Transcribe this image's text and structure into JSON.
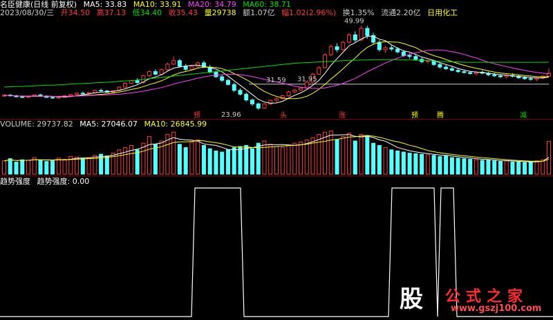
{
  "header": {
    "stock_name": "名臣健康(日线 前复权)",
    "ma5": "MA5: 33.83",
    "ma10": "MA10: 33.91",
    "ma20": "MA20: 34.79",
    "ma60": "MA60: 38.71",
    "date": "2023/08/30/三",
    "open": "开34.50",
    "high": "高37.13",
    "low": "低34.40",
    "close": "收35.43",
    "volume": "量29738",
    "amount": "额1.07亿",
    "change": "幅1.02(2.96%)",
    "turnover": "换1.35%",
    "float": "流通2.20亿",
    "industry": "日用化工"
  },
  "volume_header": {
    "volume": "VOLUME: 29737.82",
    "ma5": "MA5: 27046.07",
    "ma10": "MA10: 26845.99"
  },
  "indicator_header": {
    "name": "趋势强度",
    "value": "趋势强度: 0.00"
  },
  "watermark": {
    "char": "股",
    "text": "公式之家",
    "url": "www.gszj100.com"
  },
  "colors": {
    "up": "#ff3b3b",
    "down": "#54ffff",
    "ma5": "#ffffff",
    "ma10": "#ffff00",
    "ma20": "#ff40ff",
    "ma60": "#00e000",
    "volma5": "#ffffff",
    "volma10": "#ffff00",
    "trend": "#ffffff",
    "sep": "#7a0000"
  },
  "chart_data": [
    {
      "type": "candlestick",
      "price_range": [
        22,
        52
      ],
      "annotations": [
        {
          "label": "49.99",
          "value": 49.99
        },
        {
          "label": "23.96",
          "value": 23.96
        },
        {
          "label": "31.59",
          "value": 31.59
        },
        {
          "label": "31.95",
          "value": 31.95
        }
      ],
      "markers": [
        "预",
        "头",
        "涨",
        "预",
        "腾",
        "减"
      ],
      "candles": [
        [
          28.2,
          28.8,
          27.9,
          28.5
        ],
        [
          28.5,
          28.9,
          28.1,
          28.3
        ],
        [
          28.3,
          28.6,
          27.8,
          28.0
        ],
        [
          28.0,
          28.4,
          27.6,
          27.9
        ],
        [
          27.9,
          28.3,
          27.5,
          28.2
        ],
        [
          28.2,
          28.7,
          28.0,
          28.6
        ],
        [
          28.6,
          28.9,
          28.1,
          28.2
        ],
        [
          28.2,
          28.5,
          27.7,
          27.8
        ],
        [
          27.8,
          28.1,
          27.4,
          27.6
        ],
        [
          27.6,
          28.0,
          27.3,
          27.9
        ],
        [
          27.9,
          28.4,
          27.7,
          28.3
        ],
        [
          28.3,
          28.8,
          28.1,
          28.7
        ],
        [
          28.7,
          29.3,
          28.5,
          29.1
        ],
        [
          29.1,
          29.6,
          28.8,
          29.0
        ],
        [
          29.0,
          29.4,
          28.6,
          29.3
        ],
        [
          29.3,
          30.2,
          29.1,
          30.0
        ],
        [
          30.0,
          30.5,
          29.6,
          29.8
        ],
        [
          29.8,
          30.1,
          29.2,
          29.4
        ],
        [
          29.4,
          30.0,
          29.2,
          29.9
        ],
        [
          29.9,
          31.2,
          29.7,
          31.0
        ],
        [
          31.0,
          32.5,
          30.8,
          32.2
        ],
        [
          32.2,
          33.3,
          31.8,
          33.0
        ],
        [
          33.0,
          33.8,
          32.0,
          32.4
        ],
        [
          32.4,
          34.8,
          32.1,
          34.5
        ],
        [
          34.5,
          36.2,
          34.0,
          35.8
        ],
        [
          35.8,
          36.5,
          34.6,
          35.0
        ],
        [
          35.0,
          36.8,
          34.8,
          36.4
        ],
        [
          36.4,
          38.6,
          36.0,
          38.1
        ],
        [
          38.1,
          40.5,
          37.8,
          39.2
        ],
        [
          39.2,
          39.8,
          37.0,
          37.5
        ],
        [
          37.5,
          38.2,
          36.0,
          36.5
        ],
        [
          36.5,
          37.8,
          36.2,
          37.4
        ],
        [
          37.4,
          38.9,
          37.0,
          38.5
        ],
        [
          38.5,
          39.2,
          36.9,
          37.2
        ],
        [
          37.2,
          37.9,
          35.2,
          35.6
        ],
        [
          35.6,
          36.1,
          33.9,
          34.2
        ],
        [
          34.2,
          34.8,
          32.6,
          33.1
        ],
        [
          33.1,
          33.5,
          31.5,
          31.8
        ],
        [
          31.8,
          32.4,
          29.5,
          30.0
        ],
        [
          30.0,
          30.6,
          28.4,
          28.8
        ],
        [
          28.8,
          29.3,
          26.5,
          27.0
        ],
        [
          27.0,
          27.5,
          25.2,
          25.8
        ],
        [
          25.8,
          26.2,
          23.96,
          24.5
        ],
        [
          24.5,
          26.0,
          24.3,
          25.8
        ],
        [
          25.8,
          27.2,
          25.5,
          26.9
        ],
        [
          26.9,
          27.8,
          26.2,
          27.4
        ],
        [
          27.4,
          28.6,
          27.2,
          28.3
        ],
        [
          28.3,
          29.8,
          28.0,
          29.5
        ],
        [
          29.5,
          30.4,
          29.0,
          30.1
        ],
        [
          30.1,
          31.0,
          29.7,
          30.7
        ],
        [
          30.7,
          32.8,
          30.5,
          32.5
        ],
        [
          32.5,
          35.4,
          32.2,
          35.0
        ],
        [
          35.0,
          37.5,
          34.8,
          37.0
        ],
        [
          37.0,
          41.5,
          36.8,
          41.0
        ],
        [
          41.0,
          44.2,
          40.6,
          43.5
        ],
        [
          43.5,
          44.6,
          41.8,
          42.6
        ],
        [
          42.6,
          45.3,
          42.2,
          44.9
        ],
        [
          44.9,
          47.8,
          44.5,
          47.2
        ],
        [
          47.2,
          48.3,
          44.9,
          45.6
        ],
        [
          45.6,
          49.99,
          45.2,
          49.2
        ],
        [
          49.2,
          50.0,
          46.0,
          47.0
        ],
        [
          47.0,
          47.9,
          44.4,
          44.9
        ],
        [
          44.9,
          45.6,
          42.0,
          42.6
        ],
        [
          42.6,
          43.8,
          41.6,
          43.2
        ],
        [
          43.2,
          44.0,
          42.2,
          42.8
        ],
        [
          42.8,
          43.4,
          41.5,
          41.9
        ],
        [
          41.9,
          42.4,
          40.4,
          40.8
        ],
        [
          40.8,
          41.5,
          39.8,
          40.5
        ],
        [
          40.5,
          41.1,
          39.2,
          39.6
        ],
        [
          39.6,
          40.2,
          38.4,
          38.9
        ],
        [
          38.9,
          39.6,
          38.3,
          39.2
        ],
        [
          39.2,
          39.5,
          37.6,
          38.0
        ],
        [
          38.0,
          38.5,
          36.8,
          37.2
        ],
        [
          37.2,
          37.9,
          36.3,
          36.7
        ],
        [
          36.7,
          37.3,
          35.9,
          36.2
        ],
        [
          36.2,
          36.9,
          35.4,
          35.8
        ],
        [
          35.8,
          36.4,
          35.2,
          35.5
        ],
        [
          35.5,
          36.0,
          34.8,
          35.2
        ],
        [
          35.2,
          35.9,
          34.6,
          35.6
        ],
        [
          35.6,
          36.2,
          35.0,
          35.3
        ],
        [
          35.3,
          35.8,
          34.4,
          34.8
        ],
        [
          34.8,
          35.4,
          34.1,
          34.5
        ],
        [
          34.5,
          35.0,
          33.8,
          34.2
        ],
        [
          34.2,
          34.9,
          33.6,
          34.6
        ],
        [
          34.6,
          35.3,
          34.0,
          34.4
        ],
        [
          34.4,
          34.8,
          33.5,
          33.9
        ],
        [
          33.9,
          34.4,
          33.2,
          33.6
        ],
        [
          33.6,
          34.2,
          33.0,
          33.4
        ],
        [
          33.4,
          34.1,
          32.9,
          33.8
        ],
        [
          33.8,
          34.6,
          33.4,
          34.4
        ],
        [
          34.4,
          36.8,
          34.0,
          35.3
        ]
      ],
      "ma60": [
        31.0,
        31.1,
        31.2,
        31.2,
        31.3,
        31.4,
        31.5,
        31.6,
        31.6,
        31.7,
        31.8,
        31.9,
        32.0,
        32.1,
        32.2,
        32.3,
        32.4,
        32.5,
        32.6,
        32.8,
        32.9,
        33.0,
        33.2,
        33.4,
        33.6,
        33.8,
        34.0,
        34.2,
        34.4,
        34.6,
        34.8,
        35.0,
        35.2,
        35.4,
        35.6,
        35.8,
        36.0,
        36.2,
        36.4,
        36.6,
        36.8,
        37.0,
        37.2,
        37.4,
        37.6,
        37.8,
        38.0,
        38.2,
        38.4,
        38.5,
        38.6,
        38.7,
        38.8,
        38.9,
        39.0,
        39.1,
        39.2,
        39.3,
        39.3,
        39.4,
        39.4,
        39.5,
        39.5,
        39.5,
        39.5,
        39.5,
        39.4,
        39.4,
        39.3,
        39.3,
        39.2,
        39.1,
        39.0,
        38.9,
        38.8,
        38.8,
        38.7,
        38.7,
        38.7,
        38.7,
        38.7,
        38.7,
        38.7,
        38.7,
        38.7,
        38.7,
        38.7,
        38.7,
        38.7,
        38.7,
        38.71
      ]
    },
    {
      "type": "bar",
      "name": "VOLUME",
      "ylim": [
        0,
        40000
      ],
      "values": [
        12000,
        14000,
        11000,
        13000,
        12500,
        15000,
        13000,
        11500,
        12000,
        14500,
        13500,
        16000,
        15500,
        14000,
        15000,
        17000,
        18000,
        16500,
        19000,
        22000,
        24000,
        26000,
        22000,
        28000,
        34000,
        27000,
        30000,
        36000,
        38000,
        27000,
        24000,
        29000,
        31000,
        26000,
        23000,
        21000,
        20000,
        22000,
        24000,
        25000,
        26000,
        23000,
        28000,
        30000,
        27000,
        25000,
        24000,
        26000,
        28000,
        29000,
        31000,
        33000,
        36000,
        38000,
        39000,
        31000,
        34000,
        37000,
        30000,
        36000,
        35000,
        28000,
        26000,
        24000,
        22000,
        21000,
        20000,
        19000,
        18500,
        18000,
        17500,
        17000,
        16000,
        16500,
        15000,
        14500,
        14000,
        13500,
        13000,
        12500,
        13000,
        12000,
        11500,
        12000,
        11000,
        11500,
        10500,
        11000,
        12000,
        13000,
        29737
      ]
    },
    {
      "type": "line",
      "name": "趋势强度",
      "ylim": [
        0,
        1
      ],
      "x": [
        0,
        300,
        360,
        645,
        700,
        720,
        800
      ],
      "steps": [
        {
          "from": 282,
          "to": 348,
          "value": 1
        },
        {
          "from": 567,
          "to": 628,
          "value": 1
        },
        {
          "from": 638,
          "to": 656,
          "value": 1
        }
      ]
    }
  ]
}
